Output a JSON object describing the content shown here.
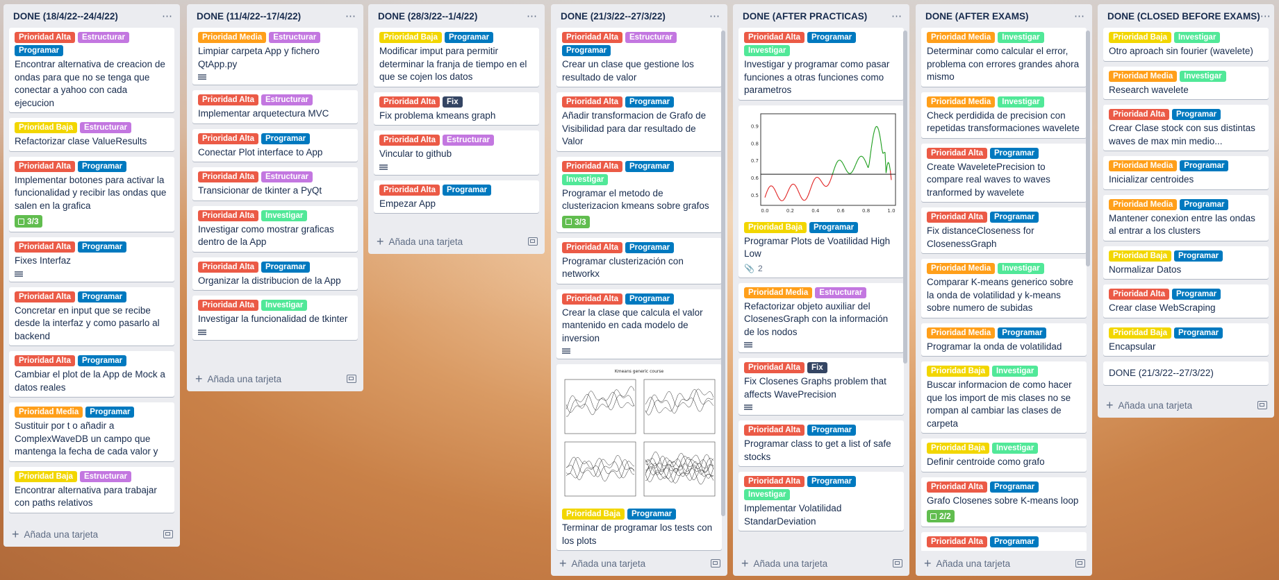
{
  "colors": {
    "Prioridad Alta": "#eb5a46",
    "Prioridad Media": "#ff9f1a",
    "Prioridad Baja": "#f2d600",
    "Estructurar": "#c377e0",
    "Programar": "#0079bf",
    "Investigar": "#51e898",
    "Fix": "#344563"
  },
  "add_card_label": "Añada una tarjeta",
  "lists": [
    {
      "title": "DONE (18/4/22--24/4/22)",
      "cards": [
        {
          "labels": [
            "Prioridad Alta",
            "Estructurar",
            "Programar"
          ],
          "title": "Encontrar alternativa de creacion de ondas para que no se tenga que conectar a yahoo con cada ejecucion"
        },
        {
          "labels": [
            "Prioridad Baja",
            "Estructurar"
          ],
          "title": "Refactorizar clase ValueResults"
        },
        {
          "labels": [
            "Prioridad Alta",
            "Programar"
          ],
          "title": "Implementar botones para activar la funcionalidad y recibir las ondas que salen en la grafica",
          "checklist": "3/3"
        },
        {
          "labels": [
            "Prioridad Alta",
            "Programar"
          ],
          "title": "Fixes Interfaz",
          "description": true
        },
        {
          "labels": [
            "Prioridad Alta",
            "Programar"
          ],
          "title": "Concretar en input que se recibe desde la interfaz y como pasarlo al backend"
        },
        {
          "labels": [
            "Prioridad Alta",
            "Programar"
          ],
          "title": "Cambiar el plot de la App de Mock a datos reales"
        },
        {
          "labels": [
            "Prioridad Media",
            "Programar"
          ],
          "title": "Sustituir por t o añadir a ComplexWaveDB un campo que mantenga la fecha de cada valor y"
        },
        {
          "labels": [
            "Prioridad Baja",
            "Estructurar"
          ],
          "title": "Encontrar alternativa para trabajar con paths relativos"
        }
      ]
    },
    {
      "title": "DONE (11/4/22--17/4/22)",
      "cards": [
        {
          "labels": [
            "Prioridad Media",
            "Estructurar"
          ],
          "title": "Limpiar carpeta App y fichero QtApp.py",
          "description": true
        },
        {
          "labels": [
            "Prioridad Alta",
            "Estructurar"
          ],
          "title": "Implementar arquetectura MVC"
        },
        {
          "labels": [
            "Prioridad Alta",
            "Programar"
          ],
          "title": "Conectar Plot interface to App"
        },
        {
          "labels": [
            "Prioridad Alta",
            "Estructurar"
          ],
          "title": "Transicionar de tkinter a PyQt"
        },
        {
          "labels": [
            "Prioridad Alta",
            "Investigar"
          ],
          "title": "Investigar como mostrar graficas dentro de la App"
        },
        {
          "labels": [
            "Prioridad Alta",
            "Programar"
          ],
          "title": "Organizar la distribucion de la App"
        },
        {
          "labels": [
            "Prioridad Alta",
            "Investigar"
          ],
          "title": "Investigar la funcionalidad de tkinter",
          "description": true
        }
      ]
    },
    {
      "title": "DONE (28/3/22--1/4/22)",
      "cards": [
        {
          "labels": [
            "Prioridad Baja",
            "Programar"
          ],
          "title": "Modificar imput para permitir determinar la franja de tiempo en el que se cojen los datos"
        },
        {
          "labels": [
            "Prioridad Alta",
            "Fix"
          ],
          "title": "Fix problema kmeans graph"
        },
        {
          "labels": [
            "Prioridad Alta",
            "Estructurar"
          ],
          "title": "Vincular to github",
          "description": true
        },
        {
          "labels": [
            "Prioridad Alta",
            "Programar"
          ],
          "title": "Empezar App"
        }
      ]
    },
    {
      "title": "DONE (21/3/22--27/3/22)",
      "cards": [
        {
          "labels": [
            "Prioridad Alta",
            "Estructurar",
            "Programar"
          ],
          "title": "Crear un clase que gestione los resultado de valor"
        },
        {
          "labels": [
            "Prioridad Alta",
            "Programar"
          ],
          "title": "Añadir transformacion de Grafo de Visibilidad para dar resultado de Valor"
        },
        {
          "labels": [
            "Prioridad Alta",
            "Programar",
            "Investigar"
          ],
          "title": "Programar el metodo de clusterizacion kmeans sobre grafos",
          "checklist": "3/3"
        },
        {
          "labels": [
            "Prioridad Alta",
            "Programar"
          ],
          "title": "Programar clusterización con networkx"
        },
        {
          "labels": [
            "Prioridad Alta",
            "Programar"
          ],
          "title": "Crear la clase que calcula el valor mantenido en cada modelo de inversion",
          "description": true
        },
        {
          "image": "kmeans",
          "image_title": "Kmeans generic course",
          "labels": [
            "Prioridad Baja",
            "Programar"
          ],
          "title": "Terminar de programar los tests con los plots"
        }
      ]
    },
    {
      "title": "DONE (AFTER PRACTICAS)",
      "cards": [
        {
          "labels": [
            "Prioridad Alta",
            "Programar",
            "Investigar"
          ],
          "title": "Investigar y programar como pasar funciones a otras funciones como parametros"
        },
        {
          "image": "volatility",
          "labels": [
            "Prioridad Baja",
            "Programar"
          ],
          "title": "Programar Plots de Voatilidad High Low",
          "attachments": "2"
        },
        {
          "labels": [
            "Prioridad Media",
            "Estructurar"
          ],
          "title": "Refactorizar objeto auxiliar del ClosenesGraph con la información de los nodos",
          "description": true
        },
        {
          "labels": [
            "Prioridad Alta",
            "Fix"
          ],
          "title": "Fix Closenes Graphs problem that affects WavePrecision",
          "description": true
        },
        {
          "labels": [
            "Prioridad Alta",
            "Programar"
          ],
          "title": "Programar class to get a list of safe stocks"
        },
        {
          "labels": [
            "Prioridad Alta",
            "Programar",
            "Investigar"
          ],
          "title": "Implementar Volatilidad StandarDeviation"
        }
      ]
    },
    {
      "title": "DONE (AFTER EXAMS)",
      "cards": [
        {
          "labels": [
            "Prioridad Media",
            "Investigar"
          ],
          "title": "Determinar como calcular el error, problema con errores grandes ahora mismo"
        },
        {
          "labels": [
            "Prioridad Media",
            "Investigar"
          ],
          "title": "Check perdidida de precision con repetidas transformaciones wavelete"
        },
        {
          "labels": [
            "Prioridad Alta",
            "Programar"
          ],
          "title": "Create WaveletePrecision to compare real waves to waves tranformed by wavelete"
        },
        {
          "labels": [
            "Prioridad Alta",
            "Programar"
          ],
          "title": "Fix distanceCloseness for ClosenessGraph"
        },
        {
          "labels": [
            "Prioridad Media",
            "Investigar"
          ],
          "title": "Comparar K-means generico sobre la onda de volatilidad y k-means sobre numero de subidas"
        },
        {
          "labels": [
            "Prioridad Media",
            "Programar"
          ],
          "title": "Programar la onda de volatilidad"
        },
        {
          "labels": [
            "Prioridad Baja",
            "Investigar"
          ],
          "title": "Buscar informacion de como hacer que los import de mis clases no se rompan al cambiar las clases de carpeta"
        },
        {
          "labels": [
            "Prioridad Baja",
            "Investigar"
          ],
          "title": "Definir centroide como grafo"
        },
        {
          "labels": [
            "Prioridad Alta",
            "Programar"
          ],
          "title": "Grafo Closenes sobre K-means loop",
          "checklist": "2/2"
        },
        {
          "labels": [
            "Prioridad Alta",
            "Programar"
          ],
          "title": ""
        }
      ]
    },
    {
      "title": "DONE (CLOSED BEFORE EXAMS)",
      "cards": [
        {
          "labels": [
            "Prioridad Baja",
            "Investigar"
          ],
          "title": "Otro aproach sin fourier (wavelete)"
        },
        {
          "labels": [
            "Prioridad Media",
            "Investigar"
          ],
          "title": "Research wavelete"
        },
        {
          "labels": [
            "Prioridad Alta",
            "Programar"
          ],
          "title": "Crear Clase stock con sus distintas waves de max min medio..."
        },
        {
          "labels": [
            "Prioridad Media",
            "Programar"
          ],
          "title": "Inicializar centroides"
        },
        {
          "labels": [
            "Prioridad Media",
            "Programar"
          ],
          "title": "Mantener conexion entre las ondas al entrar a los clusters"
        },
        {
          "labels": [
            "Prioridad Baja",
            "Programar"
          ],
          "title": "Normalizar Datos"
        },
        {
          "labels": [
            "Prioridad Alta",
            "Programar"
          ],
          "title": "Crear clase WebScraping"
        },
        {
          "labels": [
            "Prioridad Baja",
            "Programar"
          ],
          "title": "Encapsular"
        },
        {
          "labels": [],
          "title": "DONE (21/3/22--27/3/22)"
        }
      ]
    }
  ],
  "volatility_chart": {
    "x_ticks": [
      "0.0",
      "0.2",
      "0.4",
      "0.6",
      "0.8",
      "1.0"
    ],
    "y_ticks": [
      "0.5",
      "0.6",
      "0.7",
      "0.8",
      "0.9"
    ],
    "baseline": 0.62
  }
}
